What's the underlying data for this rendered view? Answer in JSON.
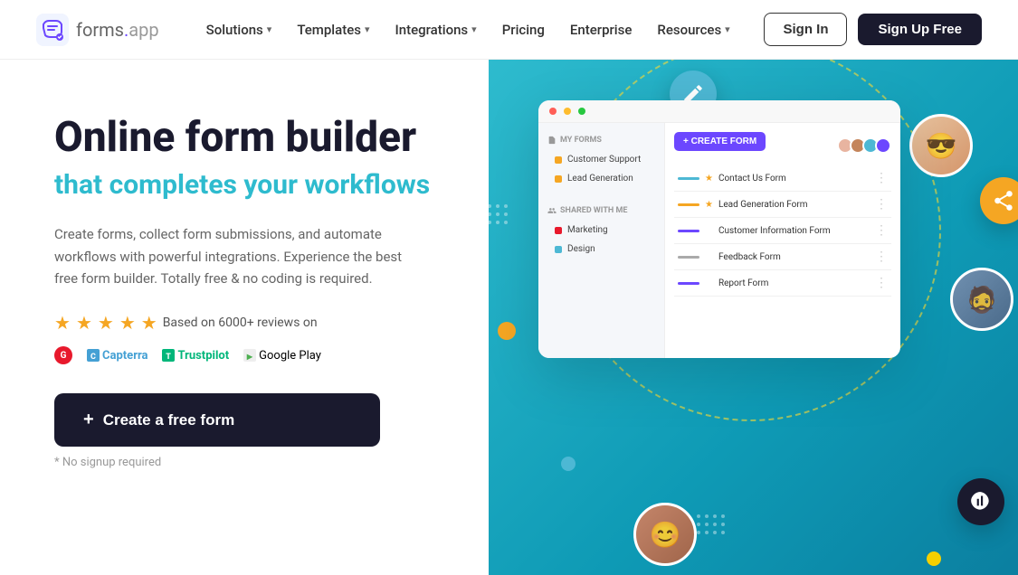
{
  "navbar": {
    "logo_text": "forms",
    "logo_dot": ".",
    "logo_app": "app",
    "nav_items": [
      {
        "label": "Solutions",
        "has_dropdown": true
      },
      {
        "label": "Templates",
        "has_dropdown": true
      },
      {
        "label": "Integrations",
        "has_dropdown": true
      },
      {
        "label": "Pricing",
        "has_dropdown": false
      },
      {
        "label": "Enterprise",
        "has_dropdown": false
      },
      {
        "label": "Resources",
        "has_dropdown": true
      }
    ],
    "signin_label": "Sign In",
    "signup_label": "Sign Up Free"
  },
  "hero": {
    "title": "Online form builder",
    "subtitle": "that completes your workflows",
    "description": "Create forms, collect form submissions, and automate workflows with powerful integrations. Experience the best free form builder. Totally free & no coding is required.",
    "reviews_text": "Based on 6000+ reviews on",
    "cta_label": "Create a free form",
    "cta_plus": "+",
    "no_signup": "* No signup required"
  },
  "badges": {
    "g2": "G",
    "capterra": "Capterra",
    "trustpilot": "Trustpilot",
    "gplay": "Google Play"
  },
  "mockup": {
    "my_forms_label": "MY FORMS",
    "shared_label": "SHARED WITH ME",
    "create_btn": "+ CREATE FORM",
    "sidebar_items_my": [
      {
        "label": "Customer Support",
        "color": "#f5a623"
      },
      {
        "label": "Lead Generation",
        "color": "#f5a623"
      }
    ],
    "sidebar_items_shared": [
      {
        "label": "Marketing",
        "color": "#e8192c"
      },
      {
        "label": "Design",
        "color": "#4db8d4"
      }
    ],
    "forms": [
      {
        "name": "Contact Us Form",
        "starred": true,
        "bar_color": "#4db8d4"
      },
      {
        "name": "Lead Generation Form",
        "starred": true,
        "bar_color": "#f5a623"
      },
      {
        "name": "Customer Information Form",
        "starred": false,
        "bar_color": "#6c47ff"
      },
      {
        "name": "Feedback Form",
        "starred": false,
        "bar_color": "#aaa"
      },
      {
        "name": "Report Form",
        "starred": false,
        "bar_color": "#6c47ff"
      }
    ]
  },
  "colors": {
    "brand_dark": "#1a1a2e",
    "brand_teal": "#2ebbce",
    "accent_purple": "#6c47ff",
    "accent_yellow": "#f5a623",
    "accent_red": "#e8192c",
    "accent_green": "#00b67a"
  }
}
